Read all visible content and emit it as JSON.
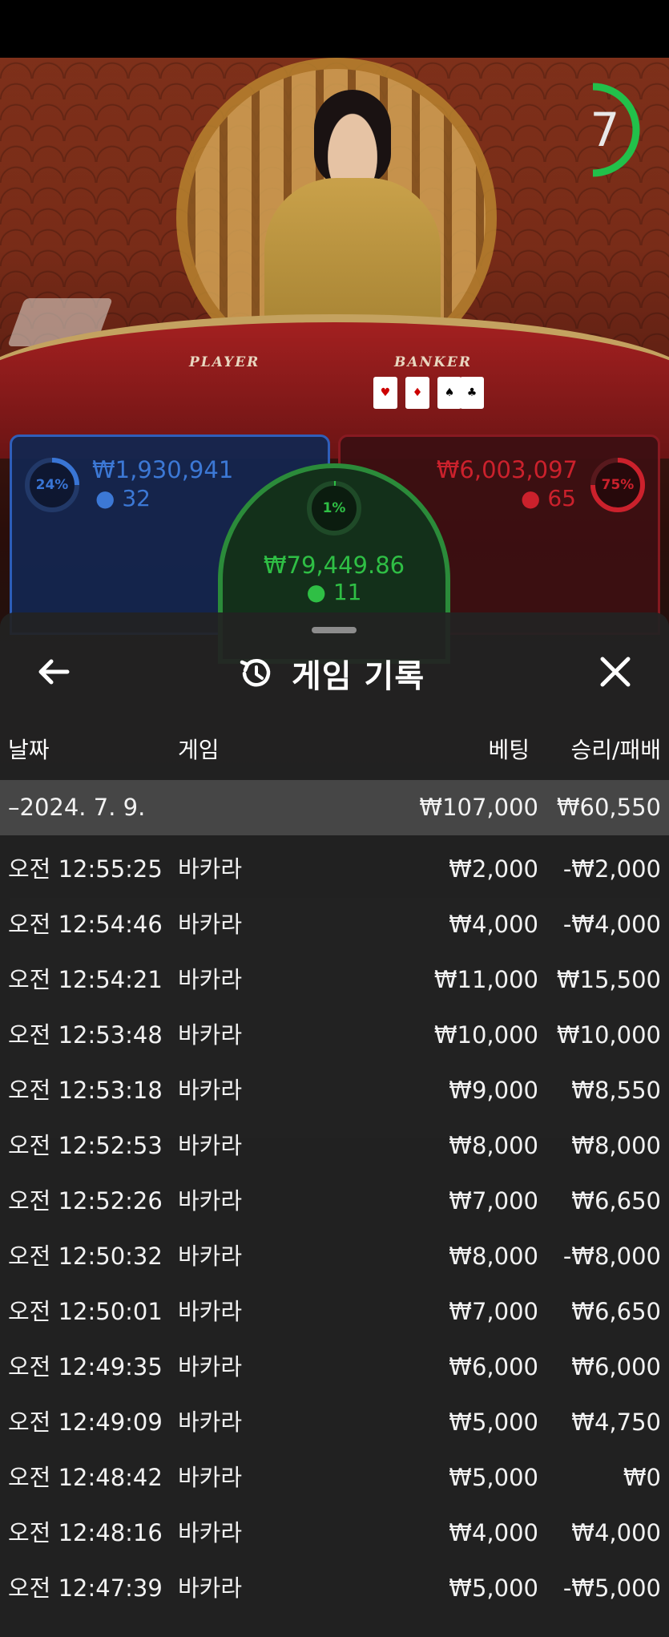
{
  "timer": "7",
  "bets": {
    "player": {
      "percent": "24%",
      "amount": "₩1,930,941",
      "players": "32"
    },
    "tie": {
      "percent": "1%",
      "amount": "₩79,449.86",
      "players": "11"
    },
    "banker": {
      "percent": "75%",
      "amount": "₩6,003,097",
      "players": "65"
    }
  },
  "table_labels": {
    "player": "PLAYER",
    "banker": "BANKER"
  },
  "modal": {
    "title": "게임 기록",
    "columns": {
      "date": "날짜",
      "game": "게임",
      "bet": "베팅",
      "result": "승리/패배"
    },
    "summary": {
      "date": "–2024. 7. 9.",
      "bet": "₩107,000",
      "result": "₩60,550"
    },
    "rows": [
      {
        "time": "오전 12:55:25",
        "game": "바카라",
        "bet": "₩2,000",
        "result": "-₩2,000"
      },
      {
        "time": "오전 12:54:46",
        "game": "바카라",
        "bet": "₩4,000",
        "result": "-₩4,000"
      },
      {
        "time": "오전 12:54:21",
        "game": "바카라",
        "bet": "₩11,000",
        "result": "₩15,500"
      },
      {
        "time": "오전 12:53:48",
        "game": "바카라",
        "bet": "₩10,000",
        "result": "₩10,000"
      },
      {
        "time": "오전 12:53:18",
        "game": "바카라",
        "bet": "₩9,000",
        "result": "₩8,550"
      },
      {
        "time": "오전 12:52:53",
        "game": "바카라",
        "bet": "₩8,000",
        "result": "₩8,000"
      },
      {
        "time": "오전 12:52:26",
        "game": "바카라",
        "bet": "₩7,000",
        "result": "₩6,650"
      },
      {
        "time": "오전 12:50:32",
        "game": "바카라",
        "bet": "₩8,000",
        "result": "-₩8,000"
      },
      {
        "time": "오전 12:50:01",
        "game": "바카라",
        "bet": "₩7,000",
        "result": "₩6,650"
      },
      {
        "time": "오전 12:49:35",
        "game": "바카라",
        "bet": "₩6,000",
        "result": "₩6,000"
      },
      {
        "time": "오전 12:49:09",
        "game": "바카라",
        "bet": "₩5,000",
        "result": "₩4,750"
      },
      {
        "time": "오전 12:48:42",
        "game": "바카라",
        "bet": "₩5,000",
        "result": "₩0"
      },
      {
        "time": "오전 12:48:16",
        "game": "바카라",
        "bet": "₩4,000",
        "result": "₩4,000"
      },
      {
        "time": "오전 12:47:39",
        "game": "바카라",
        "bet": "₩5,000",
        "result": "-₩5,000"
      }
    ]
  },
  "colors": {
    "player": "#2f6fd6",
    "banker": "#d4222e",
    "tie": "#2fbf45",
    "timer": "#22c04a"
  }
}
